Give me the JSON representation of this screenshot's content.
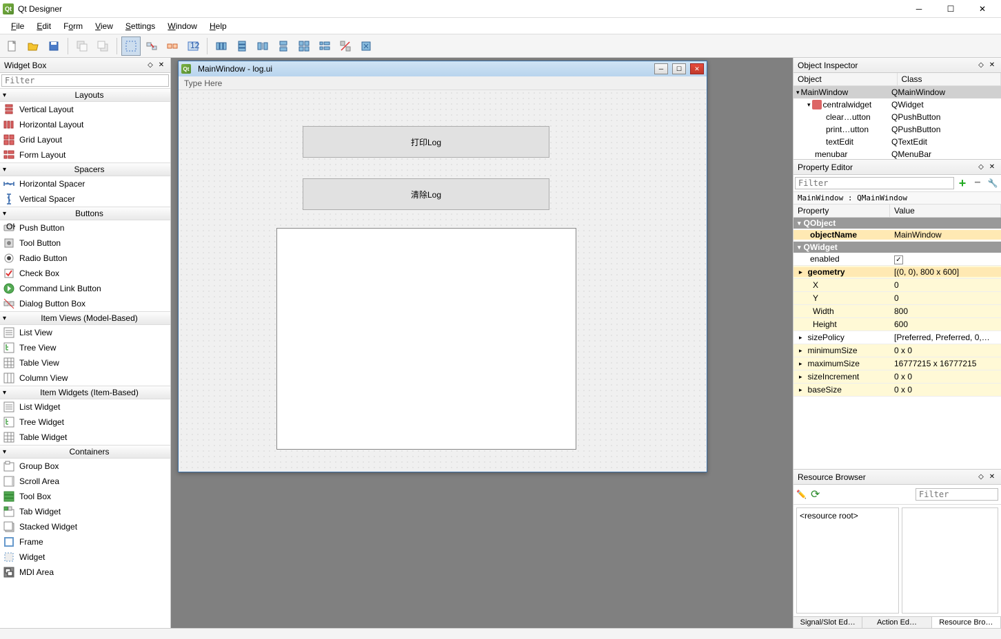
{
  "app": {
    "title": "Qt Designer"
  },
  "menus": [
    "File",
    "Edit",
    "Form",
    "View",
    "Settings",
    "Window",
    "Help"
  ],
  "widgetbox": {
    "title": "Widget Box",
    "filter_placeholder": "Filter",
    "categories": [
      {
        "name": "Layouts",
        "items": [
          "Vertical Layout",
          "Horizontal Layout",
          "Grid Layout",
          "Form Layout"
        ]
      },
      {
        "name": "Spacers",
        "items": [
          "Horizontal Spacer",
          "Vertical Spacer"
        ]
      },
      {
        "name": "Buttons",
        "items": [
          "Push Button",
          "Tool Button",
          "Radio Button",
          "Check Box",
          "Command Link Button",
          "Dialog Button Box"
        ]
      },
      {
        "name": "Item Views (Model-Based)",
        "items": [
          "List View",
          "Tree View",
          "Table View",
          "Column View"
        ]
      },
      {
        "name": "Item Widgets (Item-Based)",
        "items": [
          "List Widget",
          "Tree Widget",
          "Table Widget"
        ]
      },
      {
        "name": "Containers",
        "items": [
          "Group Box",
          "Scroll Area",
          "Tool Box",
          "Tab Widget",
          "Stacked Widget",
          "Frame",
          "Widget",
          "MDI Area"
        ]
      }
    ]
  },
  "designWindow": {
    "title": "MainWindow - log.ui",
    "menuHint": "Type Here",
    "btn1": "打印Log",
    "btn2": "清除Log"
  },
  "objectInspector": {
    "title": "Object Inspector",
    "headers": [
      "Object",
      "Class"
    ],
    "rows": [
      {
        "indent": 0,
        "name": "MainWindow",
        "cls": "QMainWindow",
        "sel": true,
        "exp": true
      },
      {
        "indent": 1,
        "name": "centralwidget",
        "cls": "QWidget",
        "exp": true,
        "icon": "widget"
      },
      {
        "indent": 2,
        "name": "clear…utton",
        "cls": "QPushButton"
      },
      {
        "indent": 2,
        "name": "print…utton",
        "cls": "QPushButton"
      },
      {
        "indent": 2,
        "name": "textEdit",
        "cls": "QTextEdit"
      },
      {
        "indent": 1,
        "name": "menubar",
        "cls": "QMenuBar"
      }
    ]
  },
  "propertyEditor": {
    "title": "Property Editor",
    "filter_placeholder": "Filter",
    "info": "MainWindow : QMainWindow",
    "headers": [
      "Property",
      "Value"
    ],
    "groups": [
      {
        "name": "QObject",
        "rows": [
          {
            "k": "objectName",
            "v": "MainWindow",
            "bold": true
          }
        ]
      },
      {
        "name": "QWidget",
        "rows": [
          {
            "k": "enabled",
            "v": "_check",
            "yel": false
          },
          {
            "k": "geometry",
            "v": "[(0, 0), 800 x 600]",
            "expand": true,
            "bold": true,
            "yel": true
          },
          {
            "k": "X",
            "v": "0",
            "sub": true,
            "yel": true
          },
          {
            "k": "Y",
            "v": "0",
            "sub": true,
            "yel": true
          },
          {
            "k": "Width",
            "v": "800",
            "sub": true,
            "yel": true
          },
          {
            "k": "Height",
            "v": "600",
            "sub": true,
            "yel": true
          },
          {
            "k": "sizePolicy",
            "v": "[Preferred, Preferred, 0,…",
            "expand": true
          },
          {
            "k": "minimumSize",
            "v": "0 x 0",
            "expand": true,
            "yel": true
          },
          {
            "k": "maximumSize",
            "v": "16777215 x 16777215",
            "expand": true,
            "yel": true
          },
          {
            "k": "sizeIncrement",
            "v": "0 x 0",
            "expand": true,
            "yel": true
          },
          {
            "k": "baseSize",
            "v": "0 x 0",
            "expand": true,
            "yel": true
          }
        ]
      }
    ]
  },
  "resourceBrowser": {
    "title": "Resource Browser",
    "filter_placeholder": "Filter",
    "root": "<resource root>"
  },
  "bottomTabs": [
    "Signal/Slot Ed…",
    "Action Ed…",
    "Resource Bro…"
  ]
}
